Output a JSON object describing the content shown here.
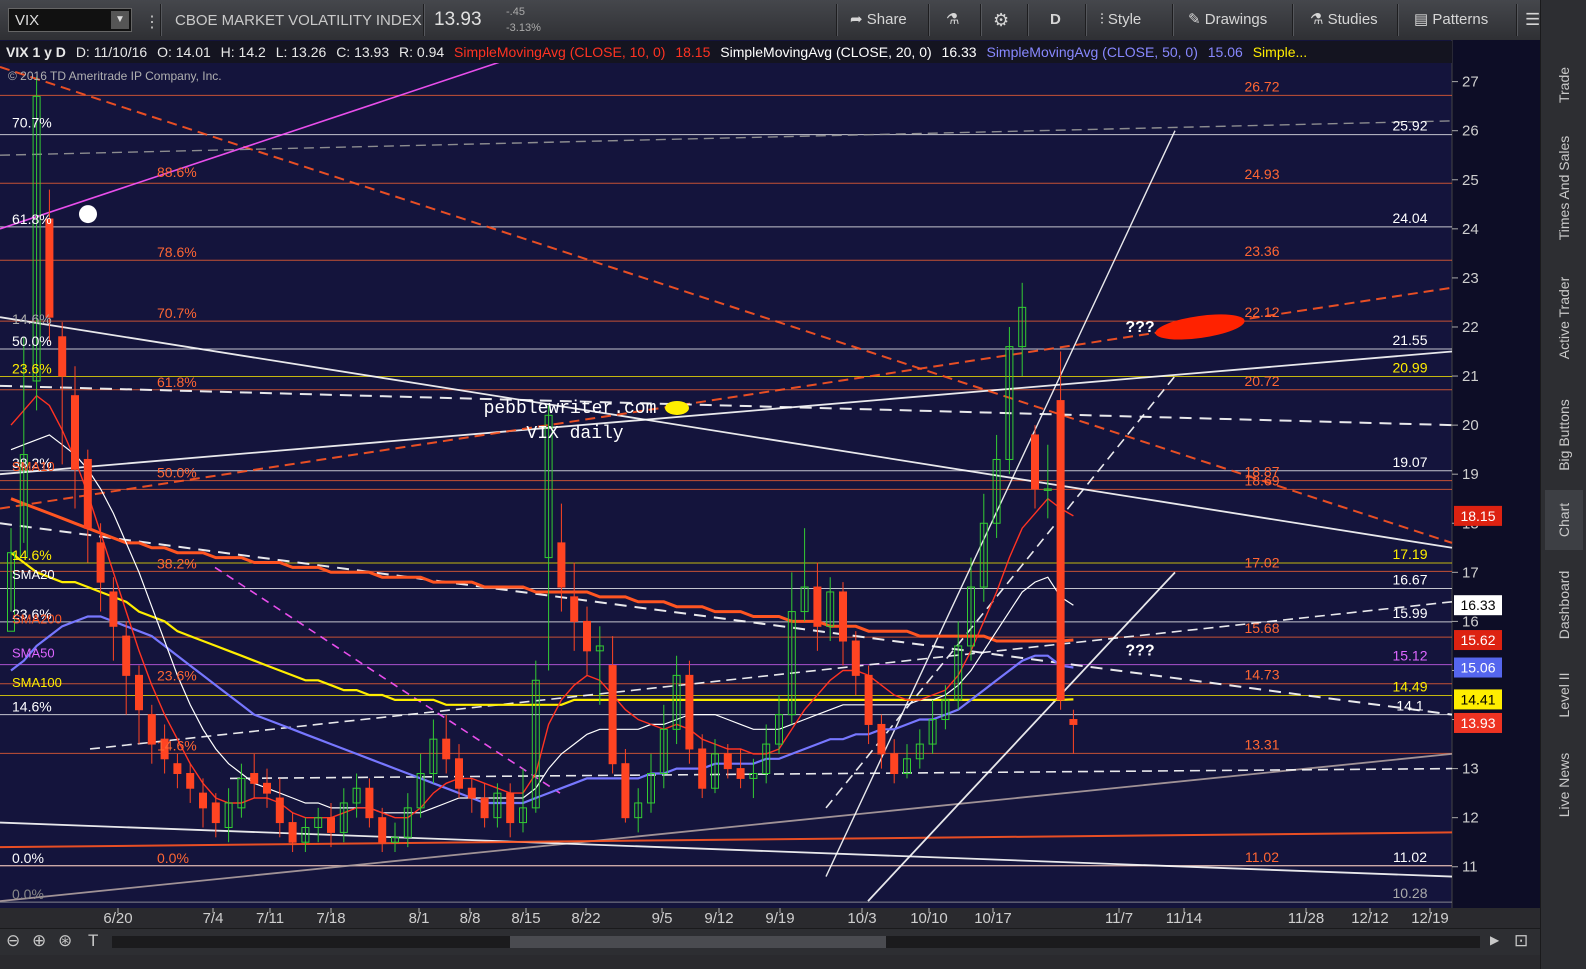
{
  "toolbar": {
    "symbol": "VIX",
    "description": "CBOE MARKET VOLATILITY INDEX",
    "last": "13.93",
    "change": "-.45",
    "change_pct": "-3.13%",
    "share": "Share",
    "aggregation": "D",
    "style": "Style",
    "drawings": "Drawings",
    "studies": "Studies",
    "patterns": "Patterns"
  },
  "side_tabs": [
    "Trade",
    "Times And Sales",
    "Active Trader",
    "Big Buttons",
    "Chart",
    "Dashboard",
    "Level II",
    "Live News"
  ],
  "infobar": {
    "symbol": "VIX 1 y D",
    "date": "D: 11/10/16",
    "open": "O: 14.01",
    "high": "H: 14.2",
    "low": "L: 13.26",
    "close": "C: 13.93",
    "range": "R: 0.94",
    "sma10": "SimpleMovingAvg (CLOSE, 10, 0)",
    "sma10_val": "18.15",
    "sma20": "SimpleMovingAvg (CLOSE, 20, 0)",
    "sma20_val": "16.33",
    "sma50": "SimpleMovingAvg (CLOSE, 50, 0)",
    "sma50_val": "15.06",
    "sma100": "Simple..."
  },
  "copyright": "© 2016 TD Ameritrade IP Company, Inc.",
  "watermark": [
    "pebblewriter.com",
    "VIX daily"
  ],
  "colors": {
    "background": "#14143c",
    "up": "#33cc33",
    "down": "#ff4422",
    "sma10": "#ff3322",
    "sma20": "#ffffff",
    "sma50": "#7777ff",
    "sma100": "#ffee00",
    "sma200": "#ff5522"
  },
  "chart_data": {
    "type": "candlestick",
    "ylim": [
      10,
      27.5
    ],
    "y_ticks": [
      11,
      12,
      13,
      14,
      15,
      16,
      17,
      18,
      19,
      20,
      21,
      22,
      23,
      24,
      25,
      26,
      27
    ],
    "x_ticks": [
      "6/20",
      "7/4",
      "7/11",
      "7/18",
      "8/1",
      "8/8",
      "8/15",
      "8/22",
      "9/5",
      "9/12",
      "9/19",
      "10/3",
      "10/10",
      "10/17",
      "11/7",
      "11/14",
      "11/28",
      "12/12",
      "12/19"
    ],
    "candles": [
      [
        15.8,
        17.4,
        16.2,
        17.9
      ],
      [
        17.3,
        19.4,
        17.6,
        21.8
      ],
      [
        20.9,
        26.7,
        20.3,
        27.1
      ],
      [
        24.2,
        22.2,
        21.7,
        24.8
      ],
      [
        21.8,
        21.0,
        19.2,
        22.1
      ],
      [
        20.6,
        19.1,
        18.3,
        21.2
      ],
      [
        19.3,
        17.9,
        17.2,
        19.5
      ],
      [
        17.6,
        16.8,
        16.2,
        18.0
      ],
      [
        16.6,
        15.9,
        15.2,
        16.9
      ],
      [
        15.7,
        14.9,
        14.1,
        16.0
      ],
      [
        14.9,
        14.2,
        13.5,
        15.1
      ],
      [
        14.1,
        13.5,
        13.1,
        14.3
      ],
      [
        13.6,
        13.2,
        12.9,
        13.9
      ],
      [
        13.1,
        12.9,
        12.6,
        13.3
      ],
      [
        12.9,
        12.6,
        12.3,
        13.1
      ],
      [
        12.5,
        12.2,
        11.8,
        12.8
      ],
      [
        12.3,
        11.9,
        11.6,
        12.5
      ],
      [
        11.8,
        12.3,
        11.5,
        12.6
      ],
      [
        12.2,
        12.8,
        12.0,
        13.1
      ],
      [
        12.9,
        12.7,
        12.4,
        13.3
      ],
      [
        12.7,
        12.5,
        12.2,
        13.0
      ],
      [
        12.4,
        11.9,
        11.6,
        12.8
      ],
      [
        11.9,
        11.5,
        11.3,
        12.1
      ],
      [
        11.5,
        11.8,
        11.3,
        12.0
      ],
      [
        11.8,
        12.0,
        11.5,
        12.2
      ],
      [
        12.0,
        11.7,
        11.4,
        12.3
      ],
      [
        11.7,
        12.3,
        11.5,
        12.6
      ],
      [
        12.3,
        12.6,
        12.0,
        12.9
      ],
      [
        12.6,
        12.0,
        11.8,
        12.8
      ],
      [
        12.0,
        11.5,
        11.3,
        12.2
      ],
      [
        11.5,
        11.6,
        11.3,
        11.9
      ],
      [
        11.6,
        12.2,
        11.4,
        12.5
      ],
      [
        12.2,
        12.9,
        12.0,
        13.3
      ],
      [
        12.9,
        13.6,
        12.7,
        14.0
      ],
      [
        13.6,
        13.2,
        12.9,
        14.1
      ],
      [
        13.2,
        12.6,
        12.4,
        13.5
      ],
      [
        12.6,
        12.4,
        12.1,
        12.8
      ],
      [
        12.4,
        12.0,
        11.8,
        12.7
      ],
      [
        12.0,
        12.5,
        11.8,
        12.7
      ],
      [
        12.5,
        11.9,
        11.6,
        12.7
      ],
      [
        11.9,
        12.2,
        11.7,
        13.0
      ],
      [
        12.2,
        14.8,
        12.1,
        15.2
      ],
      [
        17.3,
        20.2,
        15.0,
        20.4
      ],
      [
        17.6,
        16.7,
        16.2,
        18.4
      ],
      [
        16.5,
        16.0,
        15.4,
        17.2
      ],
      [
        16.0,
        15.4,
        14.9,
        16.3
      ],
      [
        15.4,
        15.5,
        14.3,
        15.9
      ],
      [
        15.1,
        13.1,
        12.9,
        15.7
      ],
      [
        13.1,
        12.0,
        11.9,
        13.4
      ],
      [
        12.0,
        12.3,
        11.7,
        12.6
      ],
      [
        12.3,
        12.9,
        12.1,
        13.3
      ],
      [
        12.9,
        13.8,
        12.6,
        14.3
      ],
      [
        13.8,
        14.9,
        13.5,
        15.3
      ],
      [
        14.9,
        13.4,
        13.1,
        15.2
      ],
      [
        13.4,
        12.6,
        12.4,
        13.7
      ],
      [
        12.6,
        13.3,
        12.5,
        13.6
      ],
      [
        13.3,
        13.0,
        12.8,
        13.5
      ],
      [
        13.0,
        12.8,
        12.6,
        13.4
      ],
      [
        12.8,
        12.9,
        12.4,
        13.2
      ],
      [
        12.9,
        13.5,
        12.7,
        13.9
      ],
      [
        13.5,
        14.1,
        13.3,
        14.5
      ],
      [
        14.1,
        16.2,
        13.9,
        17.0
      ],
      [
        16.2,
        16.7,
        16.0,
        17.9
      ],
      [
        16.7,
        15.9,
        15.4,
        17.2
      ],
      [
        15.9,
        16.6,
        15.6,
        16.9
      ],
      [
        16.6,
        15.6,
        15.1,
        16.8
      ],
      [
        15.6,
        14.9,
        14.5,
        15.8
      ],
      [
        14.9,
        13.9,
        13.5,
        15.1
      ],
      [
        13.9,
        13.3,
        13.0,
        14.1
      ],
      [
        13.3,
        12.9,
        12.7,
        13.6
      ],
      [
        12.9,
        13.2,
        12.8,
        13.5
      ],
      [
        13.2,
        13.5,
        13.0,
        13.8
      ],
      [
        13.5,
        14.0,
        13.3,
        14.4
      ],
      [
        14.0,
        14.4,
        13.8,
        14.7
      ],
      [
        14.4,
        15.5,
        14.2,
        16.0
      ],
      [
        15.5,
        16.7,
        15.2,
        17.3
      ],
      [
        16.7,
        18.0,
        16.4,
        18.6
      ],
      [
        18.0,
        19.3,
        17.7,
        19.8
      ],
      [
        19.3,
        21.6,
        19.0,
        22.0
      ],
      [
        21.6,
        22.4,
        21.0,
        22.9
      ],
      [
        19.8,
        18.7,
        18.3,
        20.0
      ],
      [
        18.7,
        18.7,
        18.1,
        19.6
      ],
      [
        20.5,
        14.4,
        14.2,
        21.5
      ],
      [
        14.0,
        13.9,
        13.3,
        14.2
      ]
    ],
    "sma10": [
      20.0,
      20.3,
      20.6,
      20.4,
      19.9,
      19.3,
      18.6,
      17.8,
      17.0,
      16.2,
      15.4,
      14.7,
      14.1,
      13.6,
      13.1,
      12.7,
      12.4,
      12.3,
      12.3,
      12.4,
      12.4,
      12.3,
      12.1,
      12.0,
      12.0,
      12.0,
      12.1,
      12.2,
      12.2,
      12.1,
      12.0,
      12.0,
      12.2,
      12.5,
      12.7,
      12.8,
      12.8,
      12.7,
      12.6,
      12.5,
      12.5,
      12.9,
      13.9,
      14.4,
      14.7,
      14.9,
      14.8,
      14.5,
      14.2,
      14.0,
      13.9,
      13.8,
      13.9,
      13.8,
      13.6,
      13.5,
      13.4,
      13.4,
      13.3,
      13.3,
      13.4,
      13.8,
      14.2,
      14.5,
      14.8,
      15.0,
      15.0,
      14.9,
      14.7,
      14.5,
      14.4,
      14.4,
      14.5,
      14.6,
      14.9,
      15.4,
      16.0,
      16.6,
      17.3,
      17.9,
      18.2,
      18.5,
      18.3,
      18.15
    ],
    "sma20": [
      19.5,
      19.6,
      19.7,
      19.8,
      19.6,
      19.4,
      19.1,
      18.7,
      18.2,
      17.6,
      17.0,
      16.3,
      15.6,
      14.9,
      14.3,
      13.8,
      13.4,
      13.1,
      12.9,
      12.7,
      12.6,
      12.5,
      12.4,
      12.3,
      12.3,
      12.2,
      12.2,
      12.2,
      12.2,
      12.1,
      12.1,
      12.1,
      12.1,
      12.2,
      12.3,
      12.4,
      12.4,
      12.4,
      12.4,
      12.4,
      12.4,
      12.6,
      13.0,
      13.3,
      13.5,
      13.7,
      13.8,
      13.8,
      13.8,
      13.8,
      13.9,
      13.9,
      14.0,
      14.1,
      14.1,
      14.1,
      14.0,
      13.9,
      13.8,
      13.8,
      13.8,
      13.9,
      14.0,
      14.1,
      14.2,
      14.3,
      14.3,
      14.3,
      14.3,
      14.3,
      14.3,
      14.4,
      14.4,
      14.5,
      14.7,
      15.0,
      15.4,
      15.8,
      16.2,
      16.6,
      16.8,
      16.9,
      16.5,
      16.33
    ],
    "sma50": [
      15.0,
      15.2,
      15.5,
      15.7,
      15.9,
      16.0,
      16.1,
      16.1,
      16.0,
      15.9,
      15.8,
      15.7,
      15.5,
      15.3,
      15.1,
      14.9,
      14.7,
      14.5,
      14.3,
      14.1,
      14.0,
      13.9,
      13.8,
      13.7,
      13.6,
      13.5,
      13.4,
      13.3,
      13.2,
      13.1,
      13.0,
      12.9,
      12.8,
      12.7,
      12.6,
      12.5,
      12.4,
      12.3,
      12.3,
      12.3,
      12.3,
      12.4,
      12.5,
      12.6,
      12.7,
      12.8,
      12.8,
      12.8,
      12.8,
      12.8,
      12.9,
      12.9,
      13.0,
      13.0,
      13.0,
      13.1,
      13.1,
      13.1,
      13.1,
      13.2,
      13.2,
      13.3,
      13.4,
      13.5,
      13.6,
      13.6,
      13.7,
      13.7,
      13.8,
      13.8,
      13.9,
      14.0,
      14.0,
      14.1,
      14.2,
      14.4,
      14.6,
      14.8,
      15.0,
      15.2,
      15.3,
      15.3,
      15.1,
      15.06
    ],
    "sma100": [
      17.4,
      17.2,
      17.0,
      16.9,
      16.8,
      16.8,
      16.7,
      16.6,
      16.5,
      16.4,
      16.2,
      16.1,
      16.0,
      15.8,
      15.7,
      15.6,
      15.5,
      15.4,
      15.3,
      15.2,
      15.1,
      15.0,
      14.9,
      14.8,
      14.8,
      14.7,
      14.6,
      14.6,
      14.5,
      14.5,
      14.4,
      14.4,
      14.4,
      14.4,
      14.3,
      14.3,
      14.3,
      14.3,
      14.3,
      14.3,
      14.3,
      14.3,
      14.3,
      14.3,
      14.4,
      14.4,
      14.4,
      14.4,
      14.4,
      14.4,
      14.4,
      14.4,
      14.4,
      14.4,
      14.4,
      14.4,
      14.4,
      14.4,
      14.4,
      14.4,
      14.4,
      14.4,
      14.4,
      14.4,
      14.4,
      14.4,
      14.4,
      14.4,
      14.4,
      14.4,
      14.4,
      14.4,
      14.4,
      14.4,
      14.4,
      14.4,
      14.4,
      14.4,
      14.4,
      14.4,
      14.4,
      14.4,
      14.4,
      14.41
    ],
    "sma200": [
      18.5,
      18.4,
      18.3,
      18.2,
      18.1,
      18.0,
      17.9,
      17.8,
      17.7,
      17.6,
      17.6,
      17.5,
      17.5,
      17.4,
      17.4,
      17.4,
      17.3,
      17.3,
      17.3,
      17.2,
      17.2,
      17.2,
      17.1,
      17.1,
      17.1,
      17.0,
      17.0,
      17.0,
      17.0,
      16.9,
      16.9,
      16.9,
      16.9,
      16.8,
      16.8,
      16.8,
      16.8,
      16.7,
      16.7,
      16.7,
      16.7,
      16.6,
      16.6,
      16.6,
      16.6,
      16.6,
      16.5,
      16.5,
      16.5,
      16.4,
      16.4,
      16.4,
      16.3,
      16.3,
      16.3,
      16.2,
      16.2,
      16.2,
      16.1,
      16.1,
      16.1,
      16.0,
      16.0,
      16.0,
      15.9,
      15.9,
      15.9,
      15.8,
      15.8,
      15.8,
      15.8,
      15.7,
      15.7,
      15.7,
      15.7,
      15.7,
      15.7,
      15.6,
      15.6,
      15.6,
      15.6,
      15.6,
      15.6,
      15.62
    ],
    "right_scale_labels": [
      {
        "value": 26.72,
        "text": "26.72",
        "color": "#ff6633"
      },
      {
        "value": 25.92,
        "text": "25.92",
        "color": "#ffffff"
      },
      {
        "value": 24.93,
        "text": "24.93",
        "color": "#ff6633"
      },
      {
        "value": 24.04,
        "text": "24.04",
        "color": "#ffffff"
      },
      {
        "value": 23.36,
        "text": "23.36",
        "color": "#ff6633"
      },
      {
        "value": 22.12,
        "text": "22.12",
        "color": "#ff6633"
      },
      {
        "value": 21.55,
        "text": "21.55",
        "color": "#ffffff"
      },
      {
        "value": 20.99,
        "text": "20.99",
        "color": "#ffee00"
      },
      {
        "value": 20.72,
        "text": "20.72",
        "color": "#ff6633"
      },
      {
        "value": 19.07,
        "text": "19.07",
        "color": "#ffffff"
      },
      {
        "value": 18.87,
        "text": "18.87",
        "color": "#ff6633"
      },
      {
        "value": 18.69,
        "text": "18.69",
        "color": "#ff6633"
      },
      {
        "value": 17.19,
        "text": "17.19",
        "color": "#ffee00"
      },
      {
        "value": 17.02,
        "text": "17.02",
        "color": "#ff6633"
      },
      {
        "value": 16.67,
        "text": "16.67",
        "color": "#ffffff"
      },
      {
        "value": 15.99,
        "text": "15.99",
        "color": "#ffffff"
      },
      {
        "value": 15.68,
        "text": "15.68",
        "color": "#ff6633"
      },
      {
        "value": 15.12,
        "text": "15.12",
        "color": "#dd66ff"
      },
      {
        "value": 14.73,
        "text": "14.73",
        "color": "#ff6633"
      },
      {
        "value": 14.49,
        "text": "14.49",
        "color": "#ffee00"
      },
      {
        "value": 14.1,
        "text": "14.1",
        "color": "#ffffff"
      },
      {
        "value": 13.31,
        "text": "13.31",
        "color": "#ff6633"
      },
      {
        "value": 11.02,
        "text": "11.02",
        "color": "#ff6633"
      },
      {
        "value": 11.02,
        "text": "11.02",
        "color": "#ffffff"
      },
      {
        "value": 10.28,
        "text": "10.28",
        "color": "#aaaaaa"
      }
    ],
    "price_flags": [
      {
        "value": 18.15,
        "text": "18.15",
        "color": "#dd2211"
      },
      {
        "value": 16.33,
        "text": "16.33",
        "color": "#ffffff"
      },
      {
        "value": 15.62,
        "text": "15.62",
        "color": "#dd2211"
      },
      {
        "value": 15.06,
        "text": "15.06",
        "color": "#5566ee"
      },
      {
        "value": 14.41,
        "text": "14.41",
        "color": "#ffee00"
      },
      {
        "value": 13.93,
        "text": "13.93",
        "color": "#ee3322"
      }
    ],
    "left_fib_labels": [
      {
        "value": 26.0,
        "text": "70.7%",
        "color": "#ffffff"
      },
      {
        "value": 24.04,
        "text": "61.8%",
        "color": "#ffffff"
      },
      {
        "value": 22.0,
        "text": "14.6%",
        "color": "#aaaaaa"
      },
      {
        "value": 21.55,
        "text": "50.0%",
        "color": "#ffffff"
      },
      {
        "value": 20.99,
        "text": "23.6%",
        "color": "#ffee00"
      },
      {
        "value": 19.07,
        "text": "38.2%",
        "color": "#ffffff"
      },
      {
        "value": 17.19,
        "text": "14.6%",
        "color": "#ffee00"
      },
      {
        "value": 15.99,
        "text": "23.6%",
        "color": "#ffffff"
      },
      {
        "value": 14.1,
        "text": "14.6%",
        "color": "#ffffff"
      },
      {
        "value": 11.02,
        "text": "0.0%",
        "color": "#ffffff"
      },
      {
        "value": 10.28,
        "text": "0.0%",
        "color": "#888888"
      }
    ],
    "mid_fib_labels": [
      {
        "value": 25.0,
        "text": "88.6%",
        "color": "#ff6633"
      },
      {
        "value": 23.36,
        "text": "78.6%",
        "color": "#ff6633"
      },
      {
        "value": 22.12,
        "text": "70.7%",
        "color": "#ff6633"
      },
      {
        "value": 20.72,
        "text": "61.8%",
        "color": "#ff6633"
      },
      {
        "value": 18.87,
        "text": "50.0%",
        "color": "#ff6633"
      },
      {
        "value": 17.02,
        "text": "38.2%",
        "color": "#ff6633"
      },
      {
        "value": 14.73,
        "text": "23.6%",
        "color": "#ff6633"
      },
      {
        "value": 13.31,
        "text": "14.6%",
        "color": "#ff6633"
      },
      {
        "value": 11.02,
        "text": "0.0%",
        "color": "#ff6633"
      }
    ],
    "sma_labels": [
      "SMA10",
      "SMA20",
      "SMA200",
      "SMA50",
      "SMA100"
    ],
    "annotations": [
      "???",
      "???"
    ]
  }
}
